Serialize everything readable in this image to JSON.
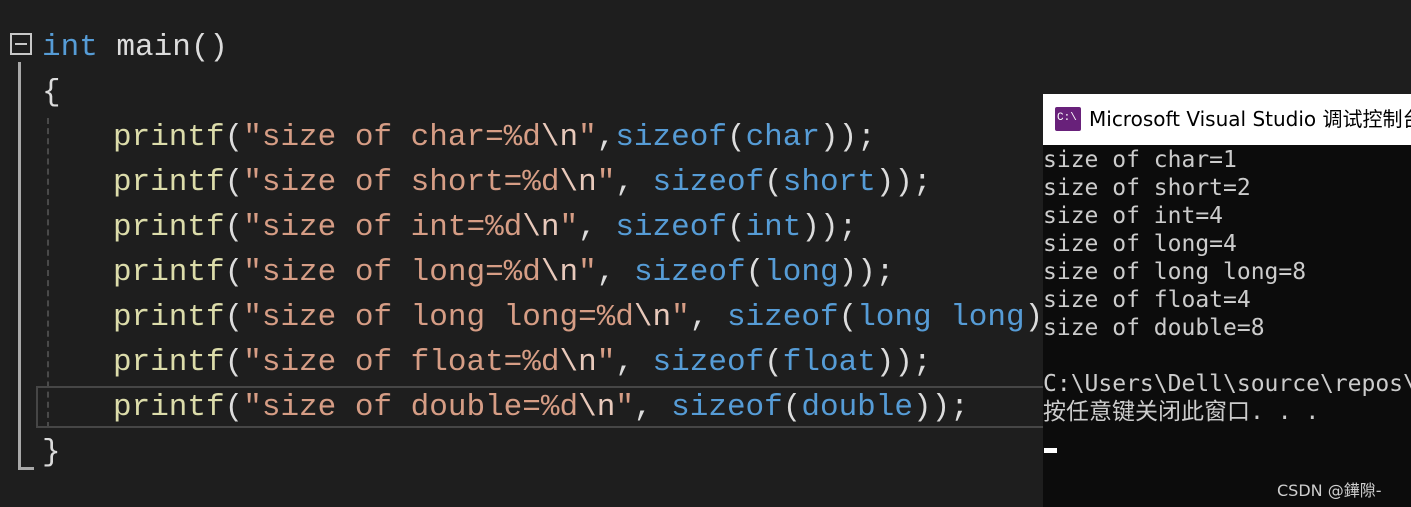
{
  "editor": {
    "lines": [
      {
        "t": [
          {
            "c": "kw",
            "v": "int"
          },
          {
            "c": "pun",
            "v": " main()"
          }
        ]
      },
      {
        "t": [
          {
            "c": "pun",
            "v": "{"
          }
        ]
      },
      {
        "t": [
          {
            "c": "fn",
            "v": "printf"
          },
          {
            "c": "pun",
            "v": "("
          },
          {
            "c": "str",
            "v": "\"size of char=%d"
          },
          {
            "c": "esc",
            "v": "\\n"
          },
          {
            "c": "str",
            "v": "\""
          },
          {
            "c": "pun",
            "v": ","
          },
          {
            "c": "kw",
            "v": "sizeof"
          },
          {
            "c": "pun",
            "v": "("
          },
          {
            "c": "kw",
            "v": "char"
          },
          {
            "c": "pun",
            "v": "));"
          }
        ]
      },
      {
        "t": [
          {
            "c": "fn",
            "v": "printf"
          },
          {
            "c": "pun",
            "v": "("
          },
          {
            "c": "str",
            "v": "\"size of short=%d"
          },
          {
            "c": "esc",
            "v": "\\n"
          },
          {
            "c": "str",
            "v": "\""
          },
          {
            "c": "pun",
            "v": ", "
          },
          {
            "c": "kw",
            "v": "sizeof"
          },
          {
            "c": "pun",
            "v": "("
          },
          {
            "c": "kw",
            "v": "short"
          },
          {
            "c": "pun",
            "v": "));"
          }
        ]
      },
      {
        "t": [
          {
            "c": "fn",
            "v": "printf"
          },
          {
            "c": "pun",
            "v": "("
          },
          {
            "c": "str",
            "v": "\"size of int=%d"
          },
          {
            "c": "esc",
            "v": "\\n"
          },
          {
            "c": "str",
            "v": "\""
          },
          {
            "c": "pun",
            "v": ", "
          },
          {
            "c": "kw",
            "v": "sizeof"
          },
          {
            "c": "pun",
            "v": "("
          },
          {
            "c": "kw",
            "v": "int"
          },
          {
            "c": "pun",
            "v": "));"
          }
        ]
      },
      {
        "t": [
          {
            "c": "fn",
            "v": "printf"
          },
          {
            "c": "pun",
            "v": "("
          },
          {
            "c": "str",
            "v": "\"size of long=%d"
          },
          {
            "c": "esc",
            "v": "\\n"
          },
          {
            "c": "str",
            "v": "\""
          },
          {
            "c": "pun",
            "v": ", "
          },
          {
            "c": "kw",
            "v": "sizeof"
          },
          {
            "c": "pun",
            "v": "("
          },
          {
            "c": "kw",
            "v": "long"
          },
          {
            "c": "pun",
            "v": "));"
          }
        ]
      },
      {
        "t": [
          {
            "c": "fn",
            "v": "printf"
          },
          {
            "c": "pun",
            "v": "("
          },
          {
            "c": "str",
            "v": "\"size of long long=%d"
          },
          {
            "c": "esc",
            "v": "\\n"
          },
          {
            "c": "str",
            "v": "\""
          },
          {
            "c": "pun",
            "v": ", "
          },
          {
            "c": "kw",
            "v": "sizeof"
          },
          {
            "c": "pun",
            "v": "("
          },
          {
            "c": "kw",
            "v": "long long"
          },
          {
            "c": "pun",
            "v": "));"
          }
        ]
      },
      {
        "t": [
          {
            "c": "fn",
            "v": "printf"
          },
          {
            "c": "pun",
            "v": "("
          },
          {
            "c": "str",
            "v": "\"size of float=%d"
          },
          {
            "c": "esc",
            "v": "\\n"
          },
          {
            "c": "str",
            "v": "\""
          },
          {
            "c": "pun",
            "v": ", "
          },
          {
            "c": "kw",
            "v": "sizeof"
          },
          {
            "c": "pun",
            "v": "("
          },
          {
            "c": "kw",
            "v": "float"
          },
          {
            "c": "pun",
            "v": "));"
          }
        ]
      },
      {
        "t": [
          {
            "c": "fn",
            "v": "printf"
          },
          {
            "c": "pun",
            "v": "("
          },
          {
            "c": "str",
            "v": "\"size of double=%d"
          },
          {
            "c": "esc",
            "v": "\\n"
          },
          {
            "c": "str",
            "v": "\""
          },
          {
            "c": "pun",
            "v": ", "
          },
          {
            "c": "kw",
            "v": "sizeof"
          },
          {
            "c": "pun",
            "v": "("
          },
          {
            "c": "kw",
            "v": "double"
          },
          {
            "c": "pun",
            "v": "));"
          }
        ]
      },
      {
        "t": [
          {
            "c": "pun",
            "v": "}"
          }
        ]
      }
    ]
  },
  "console": {
    "title": "Microsoft Visual Studio 调试控制台",
    "icon": "vs-console-icon",
    "output": [
      "size of char=1",
      "size of short=2",
      "size of int=4",
      "size of long=4",
      "size of long long=8",
      "size of float=4",
      "size of double=8",
      "",
      "C:\\Users\\Dell\\source\\repos\\",
      "按任意键关闭此窗口. . ."
    ]
  },
  "watermark": "CSDN @鏵隙-",
  "colors": {
    "background": "#1e1e1e",
    "keyword": "#569cd6",
    "function": "#dcdcaa",
    "string": "#d69d85",
    "console_bg": "#0c0c0c"
  }
}
